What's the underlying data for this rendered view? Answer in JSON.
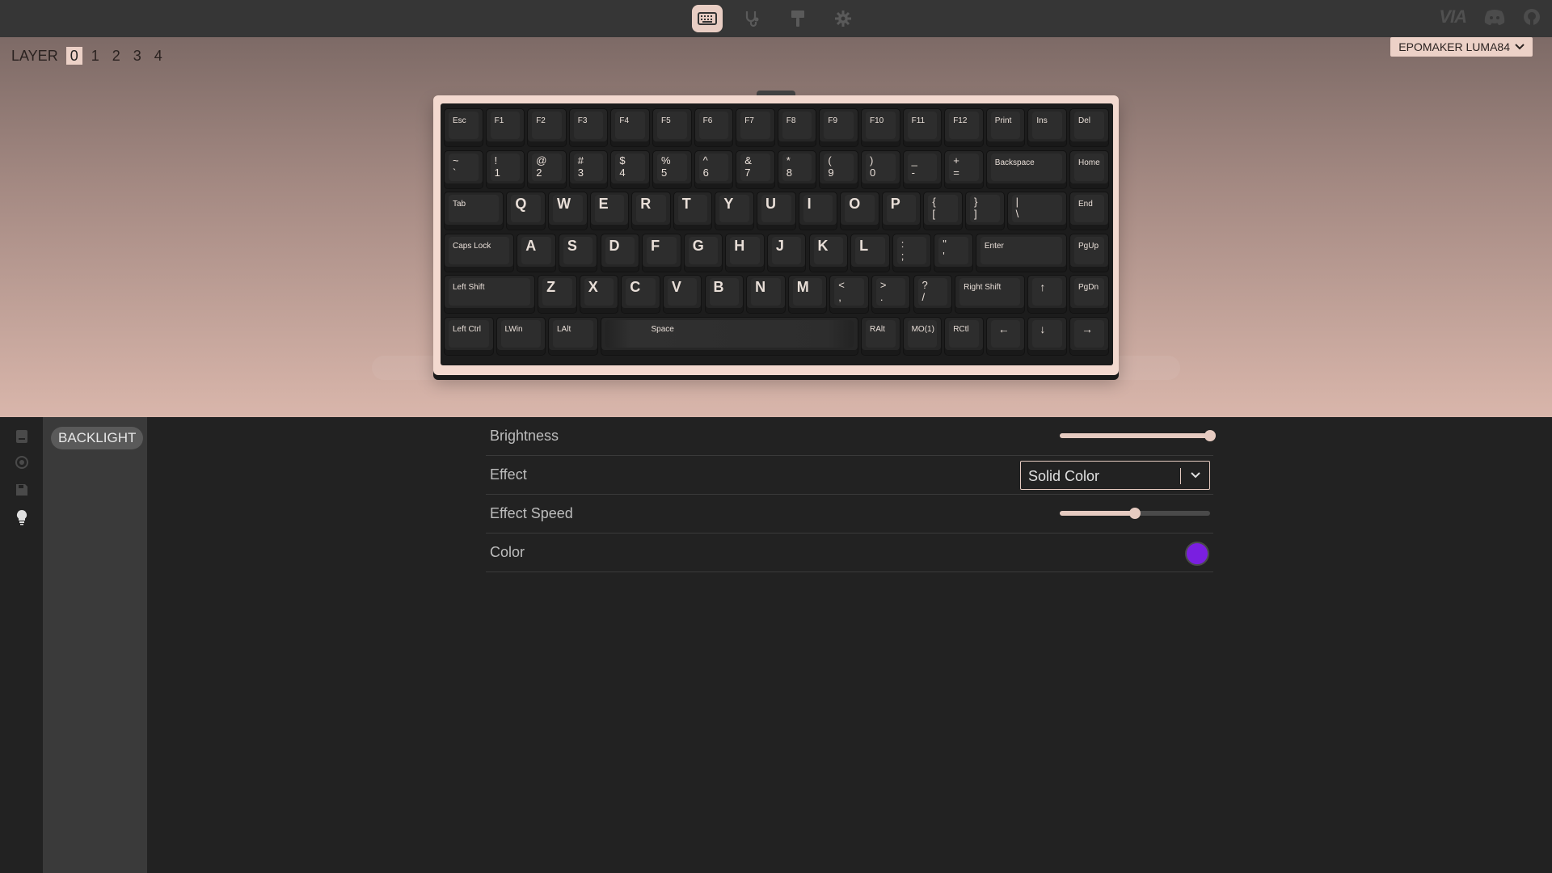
{
  "topbar": {
    "nav": [
      {
        "icon": "keyboard-icon",
        "active": true
      },
      {
        "icon": "stethoscope-icon",
        "active": false
      },
      {
        "icon": "paint-roller-icon",
        "active": false
      },
      {
        "icon": "gear-icon",
        "active": false
      }
    ],
    "right": {
      "logo_text": "VIA",
      "icons": [
        "discord-icon",
        "github-icon"
      ]
    }
  },
  "layers": {
    "label": "LAYER",
    "items": [
      "0",
      "1",
      "2",
      "3",
      "4"
    ],
    "active_index": 0
  },
  "device": {
    "name": "EPOMAKER LUMA84"
  },
  "keyboard": {
    "rows": [
      [
        "Esc",
        "F1",
        "F2",
        "F3",
        "F4",
        "F5",
        "F6",
        "F7",
        "F8",
        "F9",
        "F10",
        "F11",
        "F12",
        "Print",
        "Ins",
        "Del"
      ],
      [
        "~\n`",
        "!\n1",
        "@\n2",
        "#\n3",
        "$\n4",
        "%\n5",
        "^\n6",
        "&\n7",
        "*\n8",
        "(\n9",
        ")\n0",
        "_\n-",
        "+\n=",
        "Backspace",
        "Home"
      ],
      [
        "Tab",
        "Q",
        "W",
        "E",
        "R",
        "T",
        "Y",
        "U",
        "I",
        "O",
        "P",
        "{\n[",
        "}\n]",
        "|\n\\",
        "End"
      ],
      [
        "Caps Lock",
        "A",
        "S",
        "D",
        "F",
        "G",
        "H",
        "J",
        "K",
        "L",
        ":\n;",
        "\"\n'",
        "Enter",
        "PgUp"
      ],
      [
        "Left Shift",
        "Z",
        "X",
        "C",
        "V",
        "B",
        "N",
        "M",
        "<\n,",
        ">\n.",
        "?\n/",
        "Right Shift",
        "↑",
        "PgDn"
      ],
      [
        "Left Ctrl",
        "LWin",
        "LAlt",
        "Space",
        "RAlt",
        "MO(1)",
        "RCtl",
        "←",
        "↓",
        "→"
      ]
    ]
  },
  "side_rail": {
    "icons": [
      "keymap-icon",
      "macro-icon",
      "save-icon",
      "lightbulb-icon"
    ],
    "active_index": 3
  },
  "menu": {
    "items": [
      "BACKLIGHT"
    ]
  },
  "settings": {
    "brightness": {
      "label": "Brightness",
      "value": 1.0
    },
    "effect": {
      "label": "Effect",
      "value": "Solid Color"
    },
    "effect_speed": {
      "label": "Effect Speed",
      "value": 0.5
    },
    "color": {
      "label": "Color",
      "value": "#7a1fe0"
    }
  },
  "colors": {
    "accent": "#e6cbc1",
    "topbar_bg": "#363636",
    "panel_bg": "#222222"
  }
}
